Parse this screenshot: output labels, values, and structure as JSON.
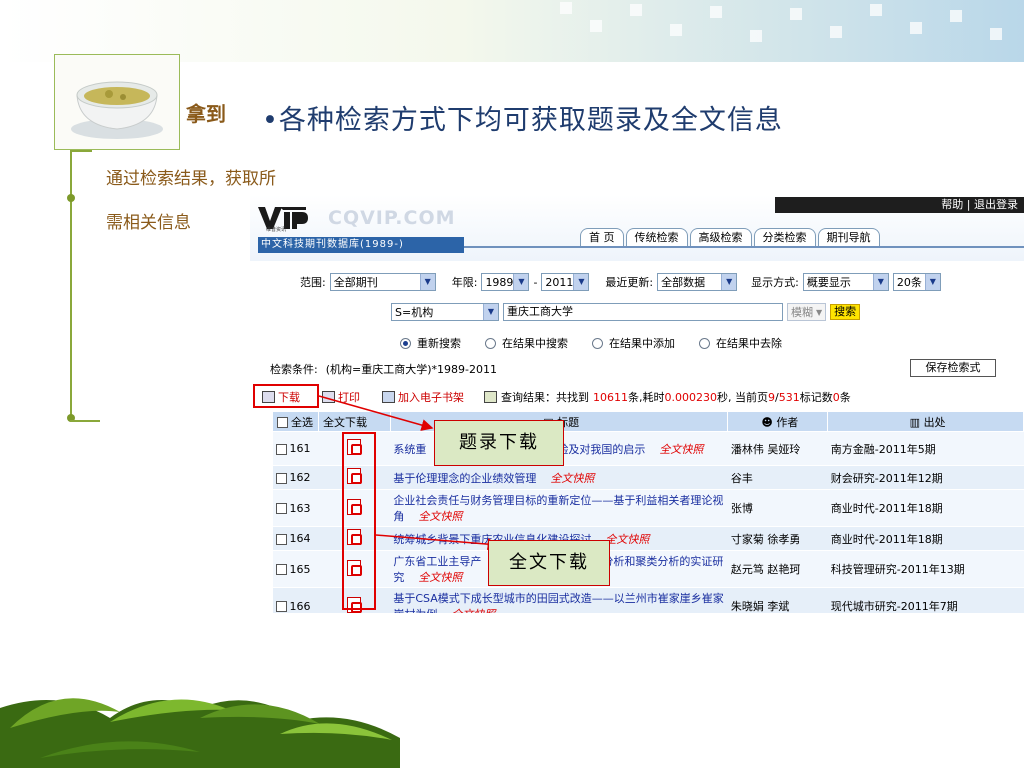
{
  "slide": {
    "tag": "拿到",
    "title": "•各种检索方式下均可获取题录及全文信息",
    "sub_line1": "通过检索结果，获取所",
    "sub_line2": "需相关信息"
  },
  "app": {
    "top_links": [
      "帮助",
      "退出登录"
    ],
    "logo_small": "维普资讯",
    "logo_brand": "CQVIP.COM",
    "db_name": "中文科技期刊数据库(1989-)",
    "nav_tabs": [
      "首  页",
      "传统检索",
      "高级检索",
      "分类检索",
      "期刊导航"
    ]
  },
  "form": {
    "scope_label": "范围:",
    "scope_value": "全部期刊",
    "years_label": "年限:",
    "year_from": "1989",
    "dash": "-",
    "year_to": "2011",
    "update_label": "最近更新:",
    "update_value": "全部数据",
    "display_label": "显示方式:",
    "display_value": "概要显示",
    "per_page": "20条",
    "field_value": "S=机构",
    "query_value": "重庆工商大学",
    "fuzzy_label": "模糊",
    "search_label": "搜索",
    "radios": [
      {
        "label": "重新搜索",
        "checked": true
      },
      {
        "label": "在结果中搜索",
        "checked": false
      },
      {
        "label": "在结果中添加",
        "checked": false
      },
      {
        "label": "在结果中去除",
        "checked": false
      }
    ],
    "condition_label": "检索条件:",
    "condition_value": "(机构=重庆工商大学)*1989-2011",
    "save_label": "保存检索式"
  },
  "toolbar": {
    "download": "下载",
    "print": "打印",
    "add_shelf": "加入电子书架",
    "result_prefix": "查询结果：共找到",
    "count": "10611",
    "unit_items": "条,耗时",
    "time": "0.000230",
    "unit_sec": "秒, 当前页",
    "page_current": "9",
    "slash": "/",
    "page_total": "531",
    "marked_prefix": "标记数",
    "marked": "0",
    "marked_suffix": "条"
  },
  "table": {
    "headers": [
      "全选",
      "全文下载",
      "标题",
      "作者",
      "出处"
    ],
    "fulltext_label": "全文快照",
    "rows": [
      {
        "no": "161",
        "title": "系统重",
        "title_tail": "经验及对我国的启示",
        "author": "潘林伟 吴娅玲",
        "source": "南方金融-2011年5期"
      },
      {
        "no": "162",
        "title": "基于伦理理念的企业绩效管理",
        "title_tail": "",
        "author": "谷丰",
        "source": "财会研究-2011年12期"
      },
      {
        "no": "163",
        "title": "企业社会责任与财务管理目标的重新定位——基于利益相关者理论视角",
        "title_tail": "",
        "author": "张博",
        "source": "商业时代-2011年18期"
      },
      {
        "no": "164",
        "title": "统筹城乡背景下重庆农业信息化建设探讨",
        "title_tail": "",
        "author": "寸家菊 徐孝勇",
        "source": "商业时代-2011年18期"
      },
      {
        "no": "165",
        "title": "广东省工业主导产",
        "title_tail": "子分析和聚类分析的实证研究",
        "author": "赵元笃 赵艳珂",
        "source": "科技管理研究-2011年13期"
      },
      {
        "no": "166",
        "title": "基于CSA模式下成长型城市的田园式改造——以兰州市崔家崖乡崔家崖村为例",
        "title_tail": "",
        "author": "朱晓娟 李斌",
        "source": "现代城市研究-2011年7期"
      }
    ]
  },
  "callouts": {
    "record_download": "题录下载",
    "fulltext_download": "全文下载"
  }
}
